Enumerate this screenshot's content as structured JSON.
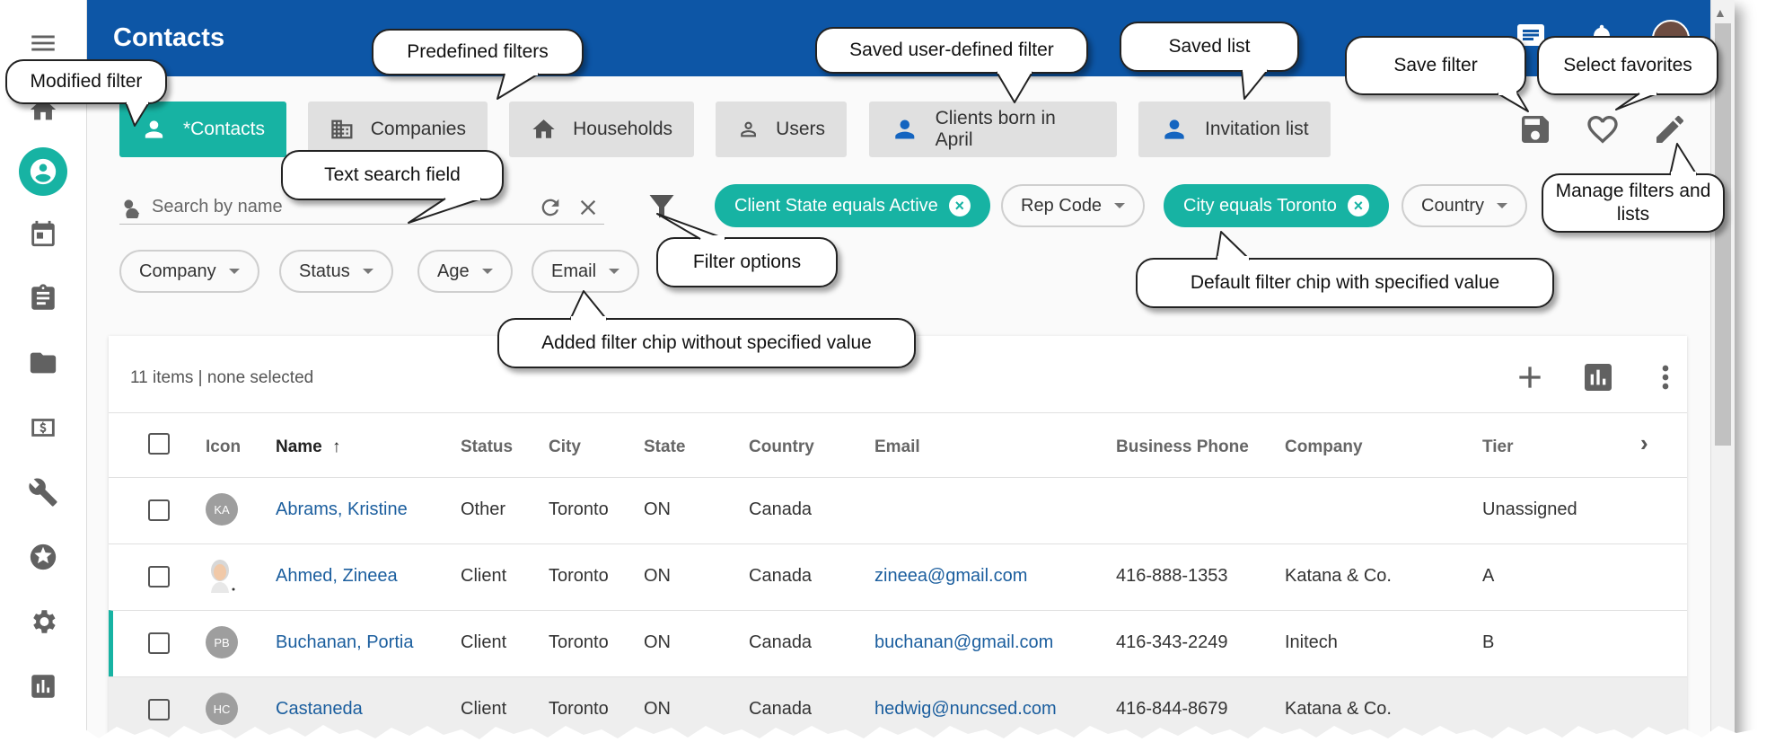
{
  "header": {
    "title": "Contacts"
  },
  "rail": {
    "items": [
      {
        "icon": "home-icon"
      },
      {
        "icon": "contacts-icon"
      },
      {
        "icon": "calendar-icon"
      },
      {
        "icon": "clipboard-icon"
      },
      {
        "icon": "folder-icon"
      },
      {
        "icon": "money-icon"
      },
      {
        "icon": "wrench-icon"
      },
      {
        "icon": "star-icon"
      },
      {
        "icon": "settings-icon"
      },
      {
        "icon": "chart-icon"
      }
    ]
  },
  "tabs": [
    {
      "label": "*Contacts",
      "icon": "person-icon",
      "selected": true
    },
    {
      "label": "Companies",
      "icon": "building-icon"
    },
    {
      "label": "Households",
      "icon": "house-icon"
    },
    {
      "label": "Users",
      "icon": "person-outline-icon"
    },
    {
      "label": "Clients born in April",
      "icon": "person-icon"
    },
    {
      "label": "Invitation list",
      "icon": "person-icon"
    }
  ],
  "search": {
    "placeholder": "Search by name",
    "value": ""
  },
  "chips": {
    "row1": [
      {
        "label": "Client State equals Active",
        "active": true
      },
      {
        "label": "Rep Code",
        "active": false
      },
      {
        "label": "City equals Toronto",
        "active": true
      },
      {
        "label": "Country",
        "active": false
      }
    ],
    "row2": [
      {
        "label": "Company"
      },
      {
        "label": "Status"
      },
      {
        "label": "Age"
      },
      {
        "label": "Email"
      }
    ]
  },
  "table": {
    "summary": "11 items | none selected",
    "columns": [
      "Icon",
      "Name",
      "Status",
      "City",
      "State",
      "Country",
      "Email",
      "Business Phone",
      "Company",
      "Tier"
    ],
    "sort_indicator": "↑",
    "rows": [
      {
        "initials": "KA",
        "name": "Abrams, Kristine",
        "status": "Other",
        "city": "Toronto",
        "state": "ON",
        "country": "Canada",
        "email": "",
        "phone": "",
        "company": "",
        "tier": "Unassigned"
      },
      {
        "initials": "",
        "name": "Ahmed, Zineea",
        "status": "Client",
        "city": "Toronto",
        "state": "ON",
        "country": "Canada",
        "email": "zineea@gmail.com",
        "phone": "416-888-1353",
        "company": "Katana & Co.",
        "tier": "A"
      },
      {
        "initials": "PB",
        "name": "Buchanan, Portia",
        "status": "Client",
        "city": "Toronto",
        "state": "ON",
        "country": "Canada",
        "email": "buchanan@gmail.com",
        "phone": "416-343-2249",
        "company": "Initech",
        "tier": "B"
      },
      {
        "initials": "HC",
        "name": "Castaneda",
        "status": "Client",
        "city": "Toronto",
        "state": "ON",
        "country": "Canada",
        "email": "hedwig@nuncsed.com",
        "phone": "416-844-8679",
        "company": "Katana & Co.",
        "tier": ""
      }
    ]
  },
  "callouts": {
    "modified_filter": "Modified filter",
    "predefined_filters": "Predefined filters",
    "saved_user_filter": "Saved user-defined filter",
    "saved_list": "Saved list",
    "save_filter": "Save filter",
    "select_favorites": "Select favorites",
    "manage_filters": "Manage filters and lists",
    "text_search": "Text search field",
    "filter_options": "Filter options",
    "default_chip": "Default filter chip with specified value",
    "added_chip": "Added filter chip without specified value"
  },
  "colors": {
    "header": "#0d56a6",
    "accent": "#17b3a3",
    "link": "#1b5e9e"
  }
}
